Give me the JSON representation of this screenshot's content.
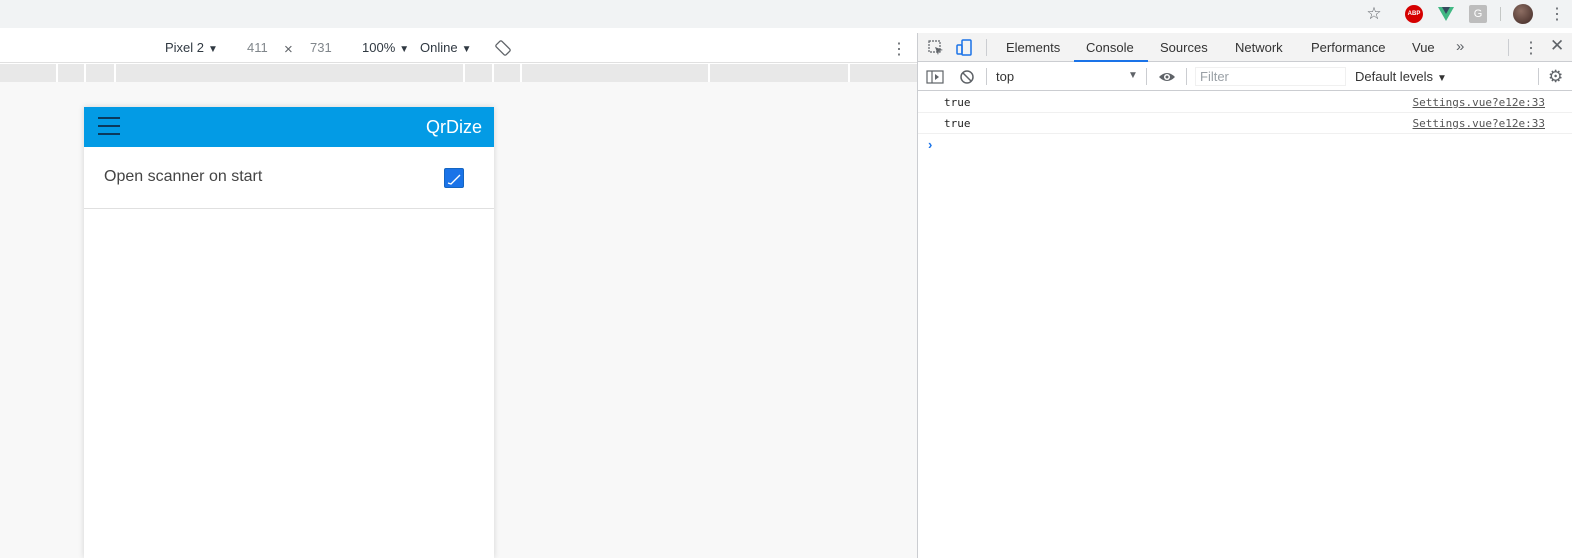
{
  "colors": {
    "app_header": "#039be5",
    "checkbox": "#1a73e8",
    "devtools_active_tab": "#1a73e8"
  },
  "browser": {
    "icons": [
      "star-icon",
      "adblock-plus-icon",
      "vue-devtools-icon",
      "grammarly-icon",
      "profile-avatar",
      "menu-icon"
    ],
    "abp_text": "ABP",
    "g_text": "G"
  },
  "device_toolbar": {
    "device": "Pixel 2",
    "width": "411",
    "times": "×",
    "height": "731",
    "zoom": "100%",
    "network": "Online"
  },
  "app": {
    "title": "QrDize",
    "settings": [
      {
        "label": "Open scanner on start",
        "checked": true
      }
    ]
  },
  "devtools": {
    "tabs": [
      "Elements",
      "Console",
      "Sources",
      "Network",
      "Performance",
      "Vue"
    ],
    "active_tab": "Console",
    "more_tabs": "»",
    "console_toolbar": {
      "context": "top",
      "filter_placeholder": "Filter",
      "levels": "Default levels"
    },
    "messages": [
      {
        "text": "true",
        "source": "Settings.vue?e12e:33"
      },
      {
        "text": "true",
        "source": "Settings.vue?e12e:33"
      }
    ],
    "prompt": "›"
  }
}
